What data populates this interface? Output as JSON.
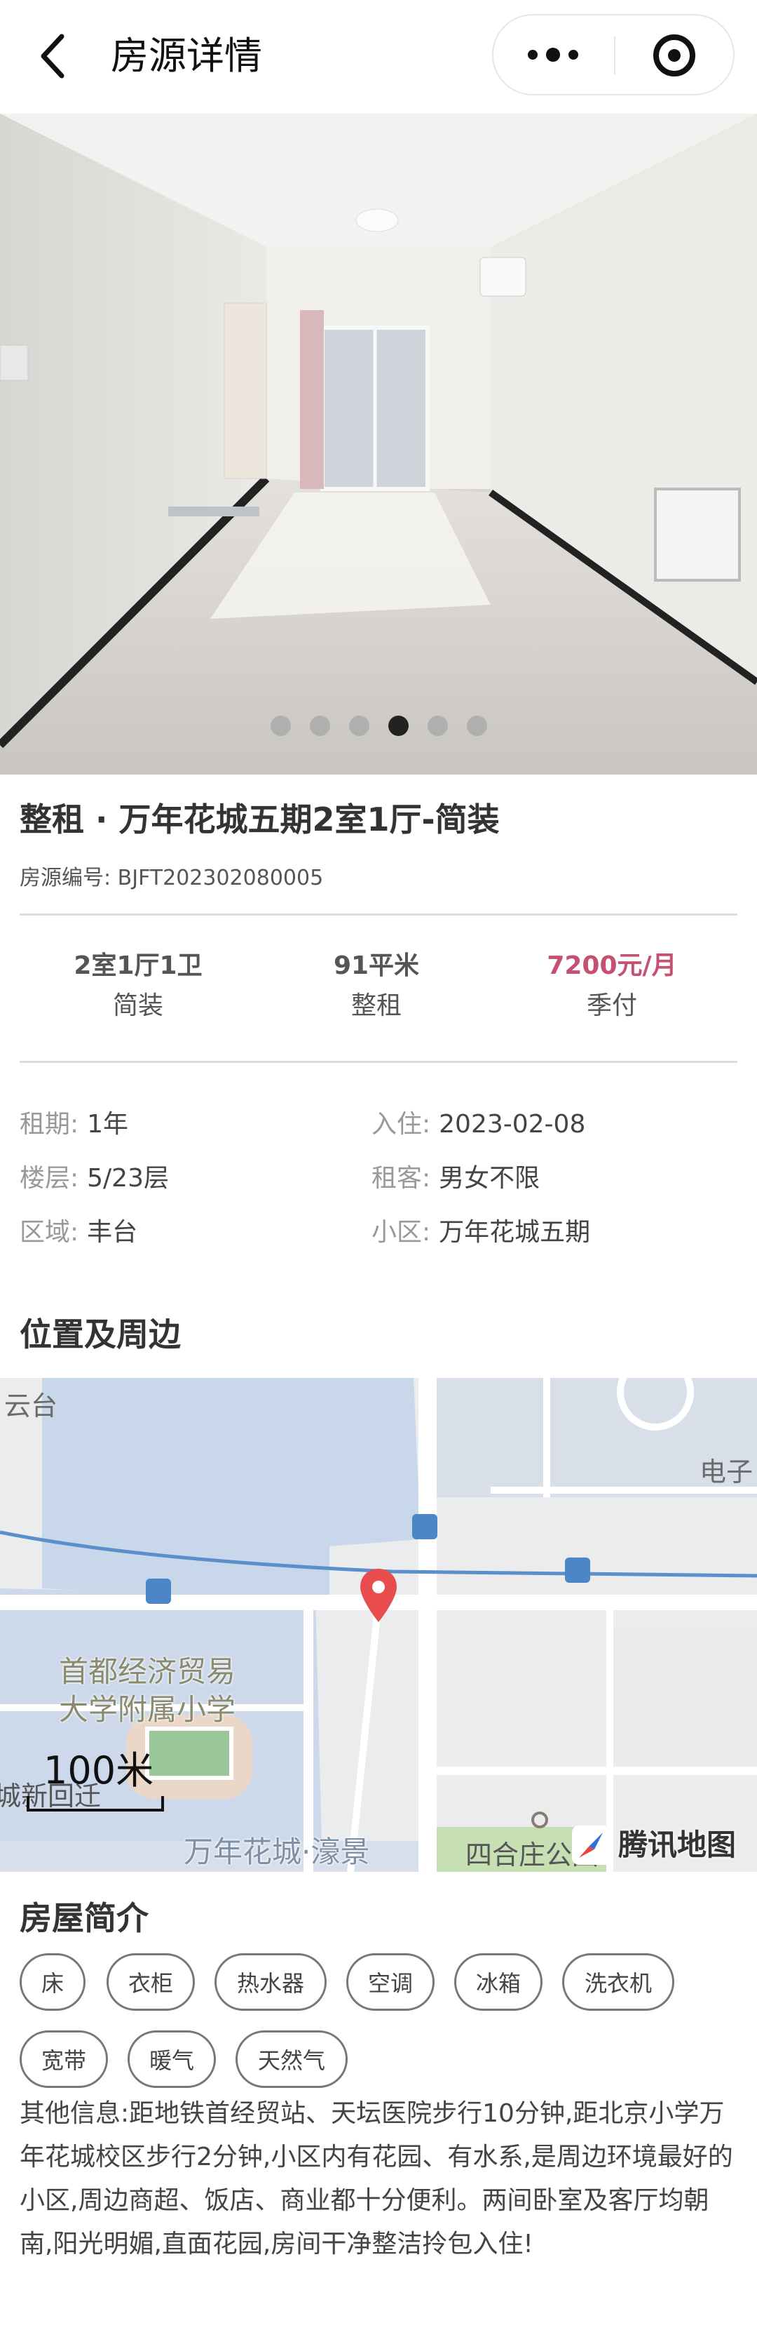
{
  "navbar": {
    "title": "房源详情",
    "back_icon": "chevron-left-icon",
    "more_icon": "more-dots-icon",
    "close_icon": "target-circle-icon"
  },
  "gallery": {
    "total": 6,
    "active_index": 3
  },
  "house": {
    "title": "整租 · 万年花城五期2室1厅-简装",
    "code": "房源编号: BJFT202302080005"
  },
  "stats": [
    {
      "value": "2室1厅1卫",
      "label": "简装"
    },
    {
      "value": "91平米",
      "label": "整租"
    },
    {
      "value": "7200元/月",
      "label": "季付"
    }
  ],
  "details": {
    "lease_key": "租期:",
    "lease_val": "1年",
    "checkin_key": "入住:",
    "checkin_val": "2023-02-08",
    "floor_key": "楼层:",
    "floor_val": "5/23层",
    "tenant_key": "租客:",
    "tenant_val": "男女不限",
    "district_key": "区域:",
    "district_val": "丰台",
    "community_key": "小区:",
    "community_val": "万年花城五期"
  },
  "location": {
    "title": "位置及周边",
    "labels": {
      "yuntai": "云台",
      "dianzi": "电子",
      "school_line1": "首都经济贸易",
      "school_line2": "大学附属小学",
      "chengxin": "城新回迁",
      "wannian": "万年花城·濠景",
      "siheyuan": "四合庄公园"
    },
    "scale": "100米",
    "brand": "腾讯地图"
  },
  "intro": {
    "title": "房屋简介",
    "tags_row1": [
      "床",
      "衣柜",
      "热水器",
      "空调",
      "冰箱",
      "洗衣机"
    ],
    "tags_row2": [
      "宽带",
      "暖气",
      "天然气"
    ],
    "description": "其他信息:距地铁首经贸站、天坛医院步行10分钟,距北京小学万年花城校区步行2分钟,小区内有花园、有水系,是周边环境最好的小区,周边商超、饭店、商业都十分便利。两间卧室及客厅均朝南,阳光明媚,直面花园,房间干净整洁拎包入住!"
  }
}
